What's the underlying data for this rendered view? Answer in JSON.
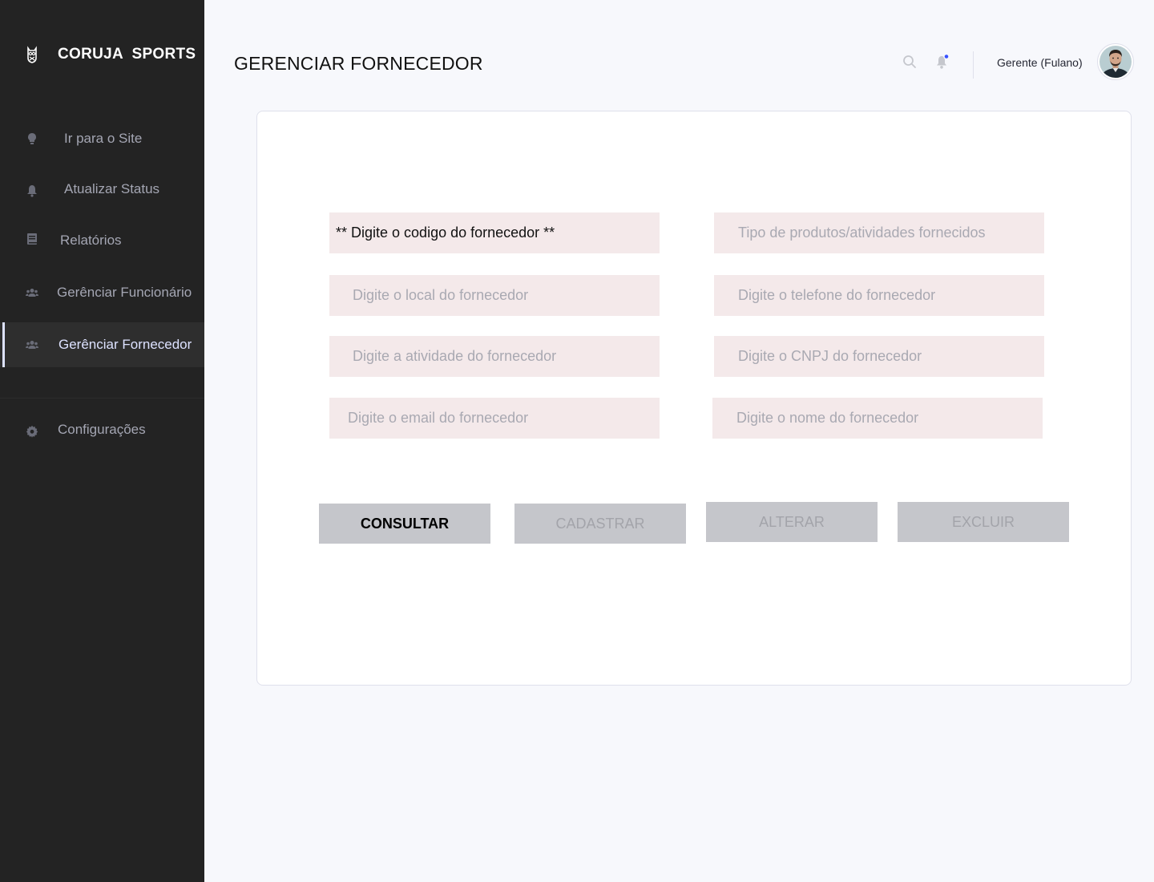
{
  "sidebar": {
    "brand": "CORUJA  SPORTS",
    "items": [
      {
        "label": "Ir para o Site",
        "icon": "lightbulb-icon"
      },
      {
        "label": "Atualizar Status",
        "icon": "bell-icon"
      },
      {
        "label": "Relatórios",
        "icon": "book-icon"
      },
      {
        "label": "Gerênciar Funcionário",
        "icon": "users-icon"
      },
      {
        "label": "Gerênciar Fornecedor",
        "icon": "users-icon",
        "active": true
      },
      {
        "label": "Configurações",
        "icon": "gear-icon"
      }
    ]
  },
  "header": {
    "title": "GERENCIAR FORNECEDOR",
    "user": "Gerente (Fulano)"
  },
  "form": {
    "code_placeholder": "** Digite o codigo do fornecedor **",
    "tipo_placeholder": "Tipo de produtos/atividades fornecidos",
    "local_placeholder": "Digite o local do fornecedor",
    "telefone_placeholder": "Digite o telefone do fornecedor",
    "atividade_placeholder": "Digite a atividade do fornecedor",
    "cnpj_placeholder": "Digite o CNPJ do fornecedor",
    "email_placeholder": "Digite o email do fornecedor",
    "nome_placeholder": "Digite o nome do fornecedor"
  },
  "actions": {
    "consultar": "CONSULTAR",
    "cadastrar": "CADASTRAR",
    "alterar": "ALTERAR",
    "excluir": "EXCLUIR"
  },
  "colors": {
    "sidebar_bg": "#232323",
    "active_accent": "#dde2ff",
    "field_bg": "#f4e9ea",
    "button_bg": "#c5c6cb",
    "notification_dot": "#3751ff"
  }
}
